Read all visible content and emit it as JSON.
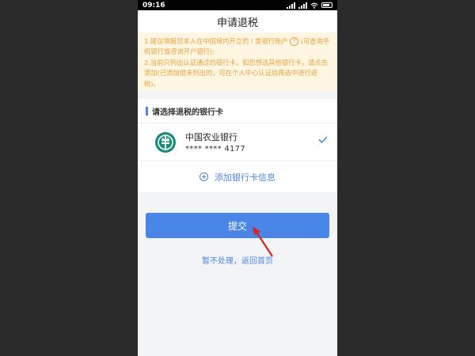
{
  "status_bar": {
    "time": "09:16",
    "battery": "60"
  },
  "header": {
    "title": "申请退税"
  },
  "notice": {
    "line1_a": "1.建议填报您本人在中国境内开立的 I 类银行账户",
    "line1_b": "(可查询手机银行或咨询开户银行);",
    "line2": "2.当前只列出认证通过的银行卡，如您想选其他银行卡，请点击添加(已添加但未列出的，可在个人中心认证后再选中进行退税)。",
    "qmark": "?"
  },
  "section": {
    "title": "请选择退税的银行卡"
  },
  "bank_card": {
    "name": "中国农业银行",
    "number": "**** **** 4177",
    "logo_icon": "abc-bank-logo-icon",
    "selected": true
  },
  "add_card": {
    "label": "添加银行卡信息"
  },
  "actions": {
    "submit_label": "提交",
    "back_label": "暂不处理，返回首页"
  },
  "colors": {
    "accent": "#4a86e8",
    "notice_bg": "#fff6e1",
    "notice_text": "#e8a245",
    "bank_logo": "#1a8c7a",
    "annotation_arrow": "#e02020"
  }
}
